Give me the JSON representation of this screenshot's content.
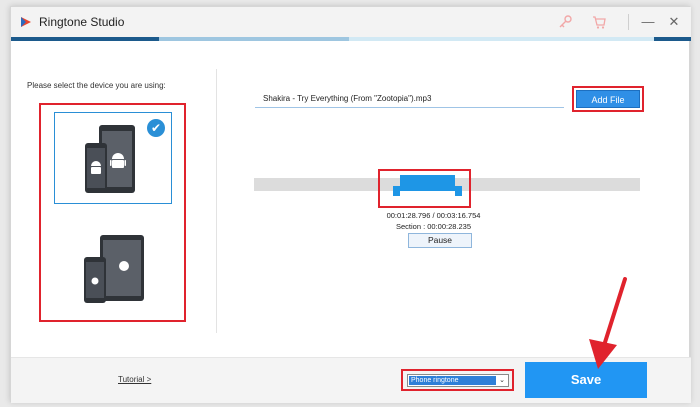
{
  "window": {
    "title": "Ringtone Studio"
  },
  "titlebar": {
    "key_icon": "key-icon",
    "cart_icon": "cart-icon",
    "minimize": "—",
    "close": "✕"
  },
  "left_panel": {
    "prompt": "Please select the device you are using:",
    "devices": [
      {
        "name": "android",
        "selected": true
      },
      {
        "name": "apple",
        "selected": false
      }
    ]
  },
  "editor": {
    "file_name": "Shakira - Try Everything (From \"Zootopia\").mp3",
    "add_file_label": "Add File",
    "time_position": "00:01:28.796 / 00:03:16.754",
    "section": "Section : 00:00:28.235",
    "pause_label": "Pause"
  },
  "bottom": {
    "tutorial_label": "Tutorial >",
    "ringtone_type": "Phone ringtone",
    "save_label": "Save"
  },
  "colors": {
    "accent": "#2196f3",
    "highlight": "#e0232d",
    "selection": "#1e96e6"
  }
}
